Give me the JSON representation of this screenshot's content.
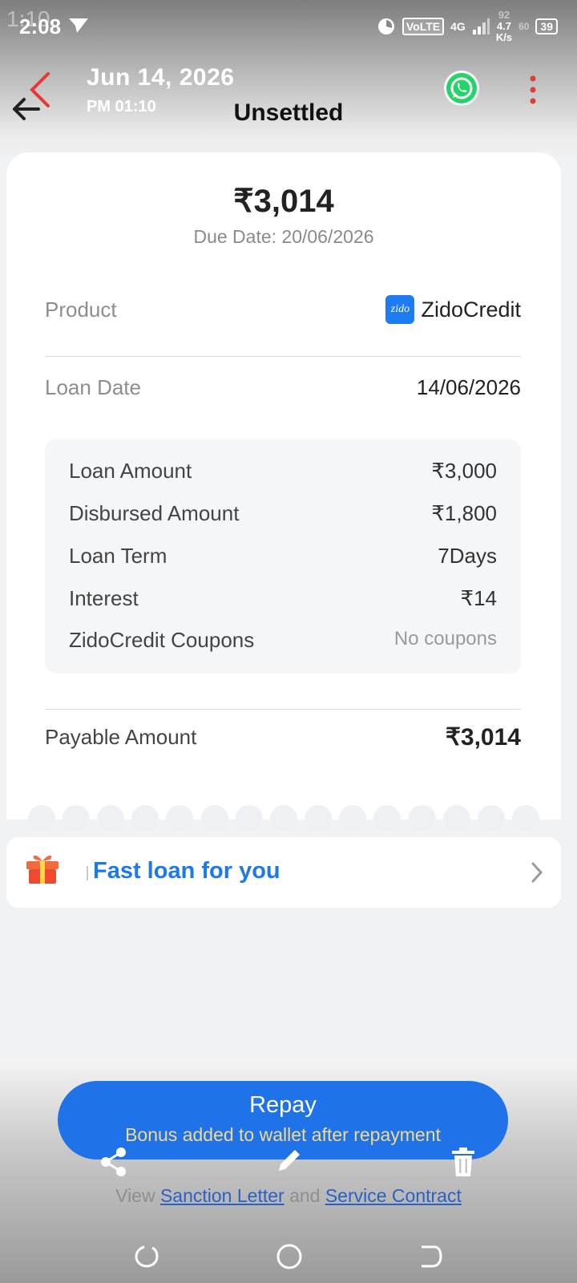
{
  "status_bar": {
    "time_back": "1:10",
    "time": "2:08",
    "network": "VoLTE",
    "signal": "4G",
    "speed_value": "4.7",
    "speed_unit": "K/s",
    "speed_back": "92",
    "battery": "39",
    "battery_back": "60"
  },
  "header": {
    "date": "Jun 14, 2026",
    "time": "PM 01:10",
    "status": "Unsettled"
  },
  "summary": {
    "amount": "₹3,014",
    "due_date": "Due Date: 20/06/2026"
  },
  "info": {
    "product_label": "Product",
    "product_logo_text": "zido",
    "product_value": "ZidoCredit",
    "loan_date_label": "Loan Date",
    "loan_date_value": "14/06/2026"
  },
  "details": [
    {
      "label": "Loan Amount",
      "value": "₹3,000"
    },
    {
      "label": "Disbursed Amount",
      "value": "₹1,800"
    },
    {
      "label": "Loan Term",
      "value": "7Days"
    },
    {
      "label": "Interest",
      "value": "₹14"
    },
    {
      "label": "ZidoCredit Coupons",
      "value": "No coupons"
    }
  ],
  "payable": {
    "label": "Payable Amount",
    "value": "₹3,014"
  },
  "promo": {
    "text": "Fast loan for you"
  },
  "repay": {
    "title": "Repay",
    "subtitle": "Bonus added to wallet after repayment"
  },
  "links": {
    "prefix": "View",
    "sanction": "Sanction Letter",
    "and": "and",
    "contract": "Service Contract"
  },
  "colors": {
    "accent": "#1f72e8",
    "promo_text": "#1d78ee",
    "whatsapp": "#25d366",
    "menu_dots": "#e53935"
  }
}
